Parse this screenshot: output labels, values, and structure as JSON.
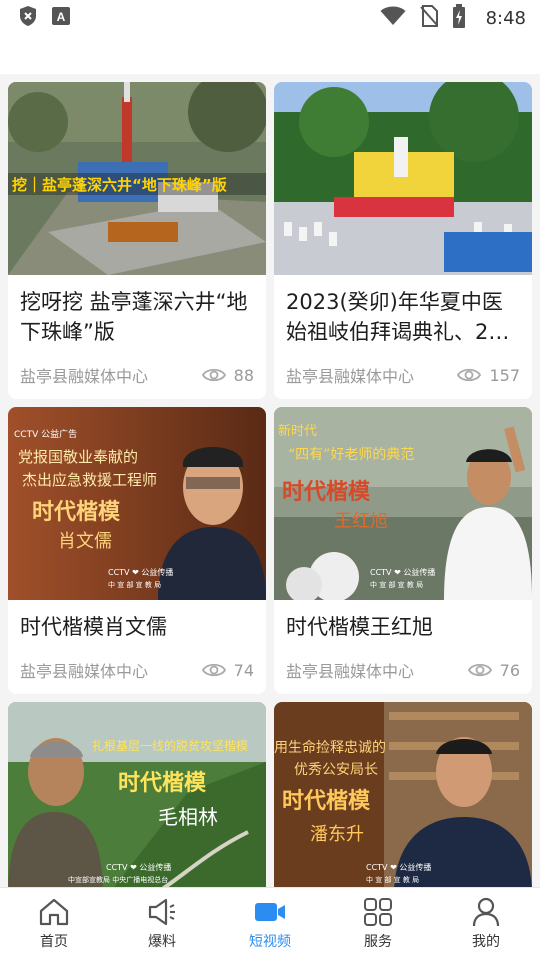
{
  "status": {
    "time": "8:48",
    "icons": [
      "shield-icon",
      "a-box-icon",
      "wifi-icon",
      "no-sim-icon",
      "battery-charging-icon"
    ]
  },
  "cards": [
    {
      "title": "挖呀挖 盐亭蓬深六井“地下珠峰”版",
      "source": "盐亭县融媒体中心",
      "views": "88",
      "overlay": "挖｜盐亭蓬深六井“地下珠峰”版"
    },
    {
      "title": "2023(癸卯)年华夏中医始祖岐伯拜谒典礼、2…",
      "source": "盐亭县融媒体中心",
      "views": "157"
    },
    {
      "title": "时代楷模肖文儒",
      "source": "盐亭县融媒体中心",
      "views": "74",
      "overlay_lines": [
        "党报国敬业奉献的",
        "杰出应急救援工程师",
        "时代楷模",
        "肖文儒"
      ],
      "overlay_brand": "CCTV ❤ 公益传播",
      "overlay_brand2": "中 宣 部 宣 教 局",
      "overlay_tl": "CCTV 公益广告"
    },
    {
      "title": "时代楷模王红旭",
      "source": "盐亭县融媒体中心",
      "views": "76",
      "overlay_lines": [
        "新时代",
        "“四有”好老师的典范",
        "时代楷模",
        "王红旭"
      ],
      "overlay_brand": "CCTV ❤ 公益传播",
      "overlay_brand2": "中 宣 部 宣 教 局"
    },
    {
      "title": "",
      "source": "",
      "views": "",
      "overlay_lines": [
        "扎根基层一线的脱贫攻坚楷模",
        "时代楷模",
        "毛相林"
      ],
      "overlay_brand": "CCTV ❤ 公益传播",
      "overlay_brand2": "中宣部宣教局  中央广播电视总台"
    },
    {
      "title": "",
      "source": "",
      "views": "",
      "overlay_lines": [
        "用生命捡释忠诚的",
        "优秀公安局长",
        "时代楷模",
        "潘东升"
      ],
      "overlay_brand": "CCTV ❤ 公益传播",
      "overlay_brand2": "中 宣 部 宣 教 局"
    }
  ],
  "nav": [
    {
      "label": "首页",
      "icon": "home-icon",
      "active": false
    },
    {
      "label": "爆料",
      "icon": "megaphone-icon",
      "active": false
    },
    {
      "label": "短视频",
      "icon": "video-camera-icon",
      "active": true
    },
    {
      "label": "服务",
      "icon": "grid-apps-icon",
      "active": false
    },
    {
      "label": "我的",
      "icon": "user-icon",
      "active": false
    }
  ],
  "colors": {
    "accent": "#2c8cf0",
    "muted": "#9a9a9a"
  }
}
